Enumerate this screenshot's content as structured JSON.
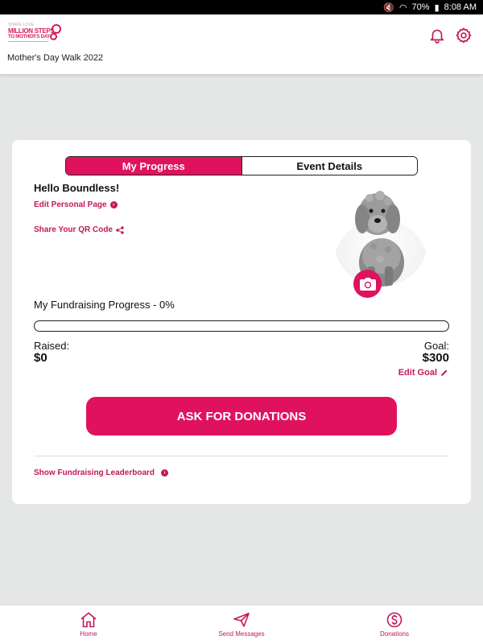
{
  "status_bar": {
    "battery": "70%",
    "time": "8:08 AM"
  },
  "header": {
    "logo": {
      "small_text": "SHARE LOVE",
      "main_text": "MILLION STEPS",
      "sub_text": "TO MOTHER'S DAY"
    },
    "event_name": "Mother's Day Walk 2022"
  },
  "tabs": [
    {
      "label": "My Progress",
      "active": true
    },
    {
      "label": "Event Details",
      "active": false
    }
  ],
  "profile": {
    "greeting": "Hello Boundless!",
    "edit_page_label": "Edit Personal Page",
    "share_qr_label": "Share Your QR Code"
  },
  "fundraising": {
    "progress_label": "My Fundraising Progress - 0%",
    "progress_fraction": 0,
    "raised_label": "Raised:",
    "raised_value": "$0",
    "goal_label": "Goal:",
    "goal_value": "$300",
    "edit_goal_label": "Edit Goal"
  },
  "ask_button_label": "ASK FOR DONATIONS",
  "leaderboard_label": "Show Fundraising Leaderboard",
  "bottom_nav": [
    {
      "label": "Home",
      "icon": "home-icon"
    },
    {
      "label": "Send Messages",
      "icon": "send-icon"
    },
    {
      "label": "Donations",
      "icon": "dollar-icon"
    }
  ],
  "colors": {
    "accent": "#e0125e",
    "link": "#c2185b"
  }
}
